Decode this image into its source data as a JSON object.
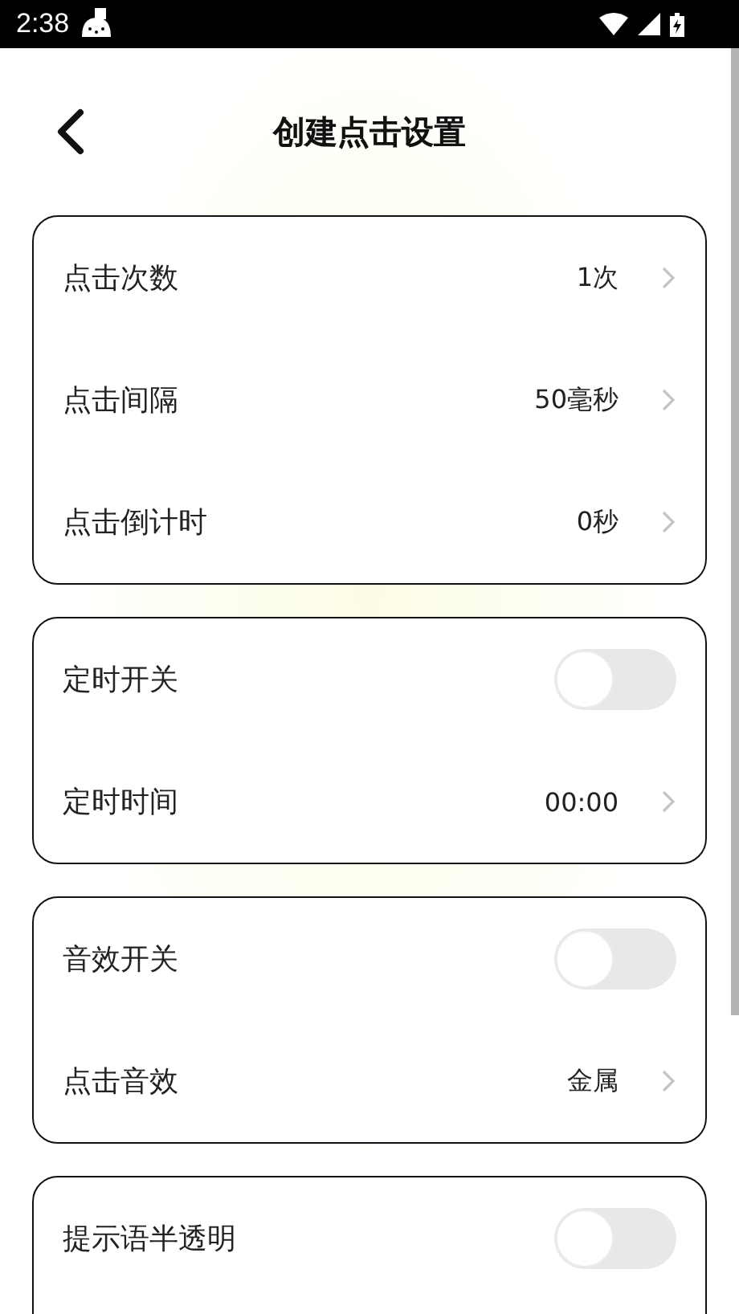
{
  "status_bar": {
    "time": "2:38"
  },
  "header": {
    "title": "创建点击设置"
  },
  "groups": [
    {
      "rows": [
        {
          "kind": "link",
          "label": "点击次数",
          "value": "1次"
        },
        {
          "kind": "link",
          "label": "点击间隔",
          "value": "50毫秒"
        },
        {
          "kind": "link",
          "label": "点击倒计时",
          "value": "0秒"
        }
      ]
    },
    {
      "rows": [
        {
          "kind": "toggle",
          "label": "定时开关",
          "on": false
        },
        {
          "kind": "link",
          "label": "定时时间",
          "value": "00:00"
        }
      ]
    },
    {
      "rows": [
        {
          "kind": "toggle",
          "label": "音效开关",
          "on": false
        },
        {
          "kind": "link",
          "label": "点击音效",
          "value": "金属"
        }
      ]
    },
    {
      "rows": [
        {
          "kind": "toggle",
          "label": "提示语半透明",
          "on": false
        }
      ]
    }
  ]
}
